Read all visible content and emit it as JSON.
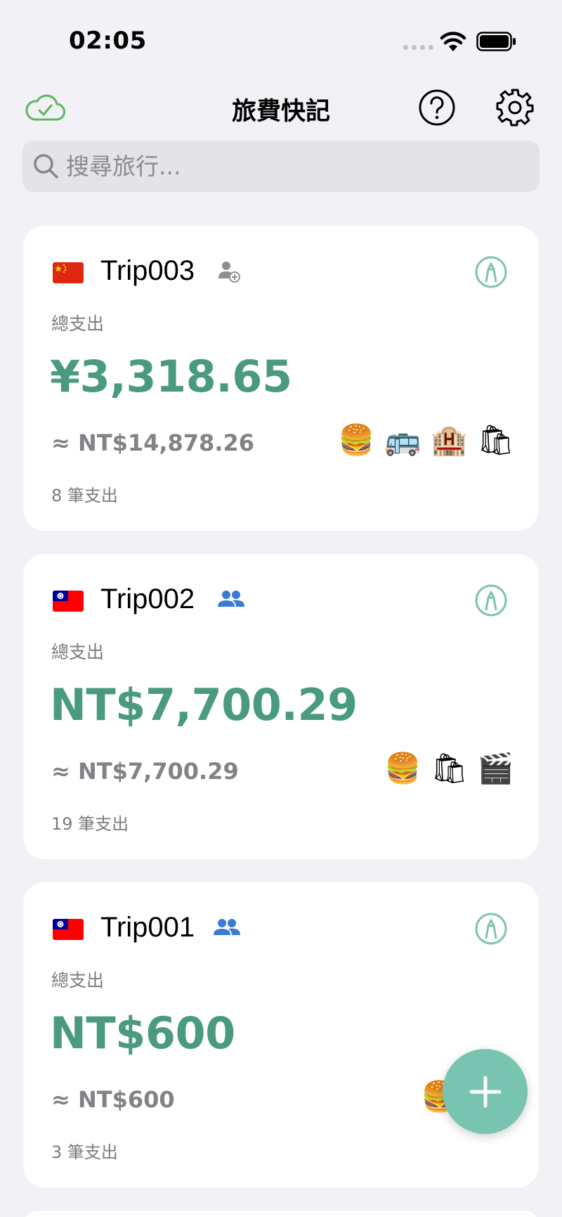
{
  "status_bar": {
    "time": "02:05"
  },
  "header": {
    "title": "旅費快記",
    "sync_icon": "cloud-check-icon",
    "help_icon": "question-circle-icon",
    "settings_icon": "gear-icon"
  },
  "search": {
    "placeholder": "搜尋旅行..."
  },
  "colors": {
    "accent_green": "#4a9b7d",
    "fab": "#79c4b0",
    "share_gray": "#8e8e93",
    "share_blue": "#3a7bd5"
  },
  "trips": [
    {
      "name": "Trip003",
      "flag": "china-flag",
      "share_icon": "person-add-icon",
      "total_label": "總支出",
      "total_amount": "¥3,318.65",
      "converted_amount": "≈ NT$14,878.26",
      "expense_count": "8 筆支出",
      "categories": [
        "🍔",
        "🚌",
        "🏨",
        "🛍"
      ]
    },
    {
      "name": "Trip002",
      "flag": "taiwan-flag",
      "share_icon": "people-icon",
      "total_label": "總支出",
      "total_amount": "NT$7,700.29",
      "converted_amount": "≈ NT$7,700.29",
      "expense_count": "19 筆支出",
      "categories": [
        "🍔",
        "🛍",
        "🎬"
      ]
    },
    {
      "name": "Trip001",
      "flag": "taiwan-flag",
      "share_icon": "people-icon",
      "total_label": "總支出",
      "total_amount": "NT$600",
      "converted_amount": "≈ NT$600",
      "expense_count": "3 筆支出",
      "categories": [
        "🍔"
      ]
    }
  ],
  "fab": {
    "icon": "plus-icon"
  }
}
